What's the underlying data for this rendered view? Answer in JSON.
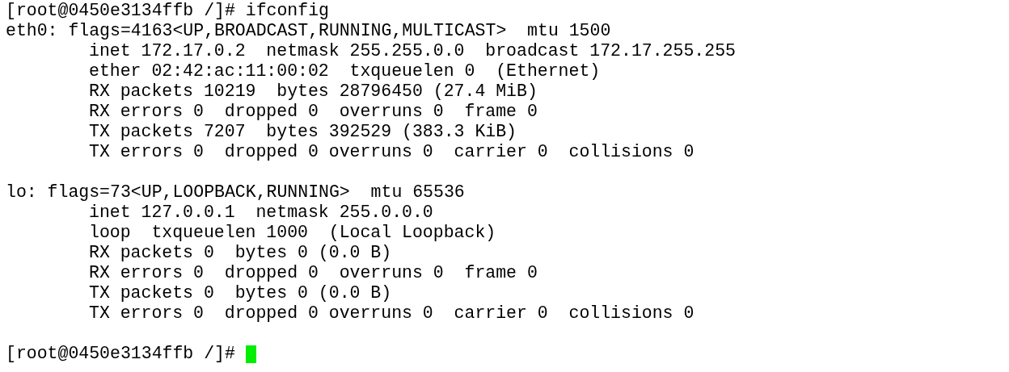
{
  "command_line": "[root@0450e3134ffb /]# ifconfig",
  "blocks": [
    {
      "header": "eth0: flags=4163<UP,BROADCAST,RUNNING,MULTICAST>  mtu 1500",
      "lines": [
        "inet 172.17.0.2  netmask 255.255.0.0  broadcast 172.17.255.255",
        "ether 02:42:ac:11:00:02  txqueuelen 0  (Ethernet)",
        "RX packets 10219  bytes 28796450 (27.4 MiB)",
        "RX errors 0  dropped 0  overruns 0  frame 0",
        "TX packets 7207  bytes 392529 (383.3 KiB)",
        "TX errors 0  dropped 0 overruns 0  carrier 0  collisions 0"
      ]
    },
    {
      "header": "lo: flags=73<UP,LOOPBACK,RUNNING>  mtu 65536",
      "lines": [
        "inet 127.0.0.1  netmask 255.0.0.0",
        "loop  txqueuelen 1000  (Local Loopback)",
        "RX packets 0  bytes 0 (0.0 B)",
        "RX errors 0  dropped 0  overruns 0  frame 0",
        "TX packets 0  bytes 0 (0.0 B)",
        "TX errors 0  dropped 0 overruns 0  carrier 0  collisions 0"
      ]
    }
  ],
  "prompt": "[root@0450e3134ffb /]#",
  "cursor": true
}
